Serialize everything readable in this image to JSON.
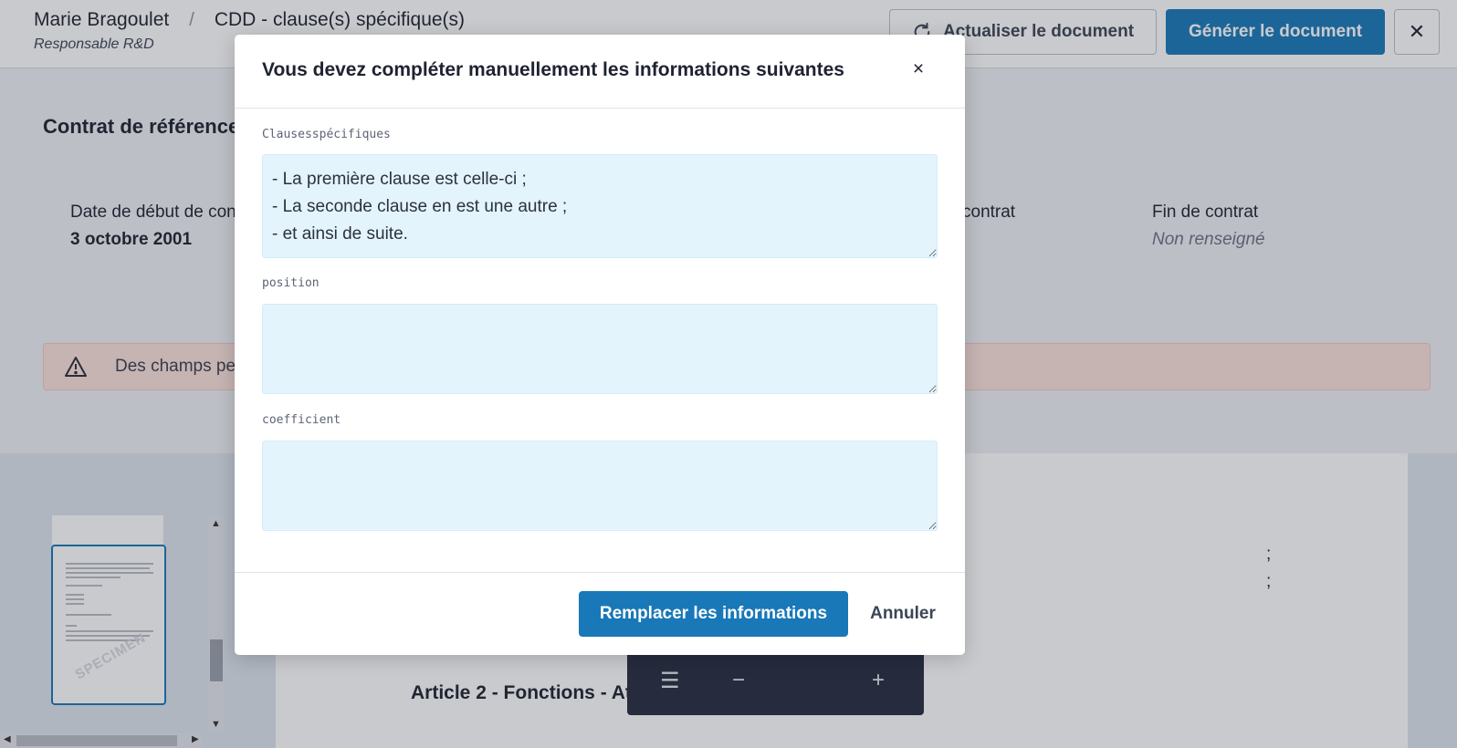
{
  "header": {
    "employee_name": "Marie Bragoulet",
    "separator": "/",
    "document_title": "CDD - clause(s) spécifique(s)",
    "employee_role": "Responsable R&D",
    "refresh_label": "Actualiser le document",
    "generate_label": "Générer le document",
    "close_label": "✕"
  },
  "contract": {
    "section_title": "Contrat de référence",
    "start_label": "Date de début de contrat",
    "start_value": "3 octobre 2001",
    "middle_label_fragment": "contrat",
    "end_label": "Fin de contrat",
    "end_value": "Non renseigné"
  },
  "alert": {
    "text": "Des champs per"
  },
  "document": {
    "line_end_1": ";",
    "line_end_2": ";",
    "article_heading": "Article 2 - Fonctions - Att",
    "watermark": "SPECIMEN",
    "toolbar": {
      "menu_icon": "☰",
      "zoom_out": "−",
      "zoom_in": "+"
    }
  },
  "modal": {
    "title": "Vous devez compléter manuellement les informations suivantes",
    "close_label": "×",
    "fields": [
      {
        "label": "Clausesspécifiques",
        "value": "- La première clause est celle-ci ;\n- La seconde clause en est une autre ;\n- et ainsi de suite."
      },
      {
        "label": "position",
        "value": ""
      },
      {
        "label": "coefficient",
        "value": ""
      }
    ],
    "primary_label": "Remplacer les informations",
    "cancel_label": "Annuler"
  },
  "colors": {
    "primary": "#1878b8",
    "field_bg": "#e3f4fd",
    "alert_bg": "#fbe2dd",
    "toolbar_bg": "#262c40"
  }
}
